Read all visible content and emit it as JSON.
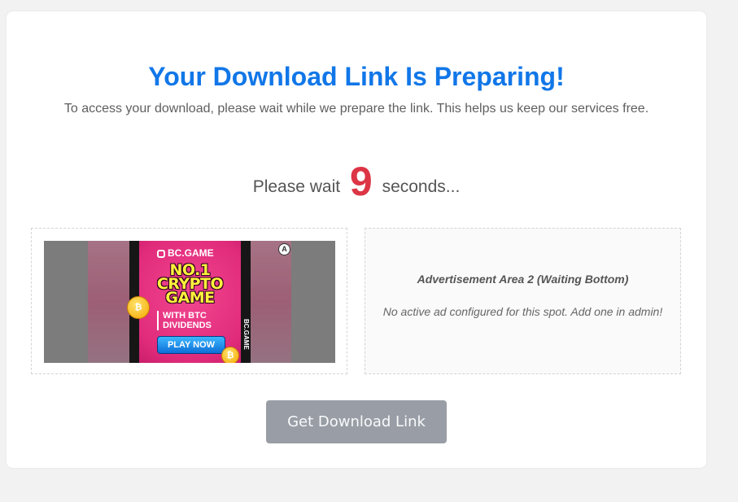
{
  "page": {
    "title": "Your Download Link Is Preparing!",
    "subtitle": "To access your download, please wait while we prepare the link. This helps us keep our services free."
  },
  "countdown": {
    "prefix": "Please wait",
    "seconds": "9",
    "suffix": "seconds..."
  },
  "ads": {
    "left": {
      "brand": "BC.GAME",
      "headline_line1": "NO.1",
      "headline_line2": "CRYPTO",
      "headline_line3": "GAME",
      "tagline_line1": "WITH BTC",
      "tagline_line2": "DIVIDENDS",
      "cta": "PLAY NOW",
      "side_brand": "BC.GAME",
      "adchoices_glyph": "A"
    },
    "right": {
      "heading": "Advertisement Area 2 (Waiting Bottom)",
      "note": "No active ad configured for this spot. Add one in admin!"
    }
  },
  "button": {
    "label": "Get Download Link"
  },
  "colors": {
    "title": "#1177e8",
    "countdown": "#dc3545",
    "button_bg": "#999ea6",
    "page_bg": "#f2f2f2"
  }
}
